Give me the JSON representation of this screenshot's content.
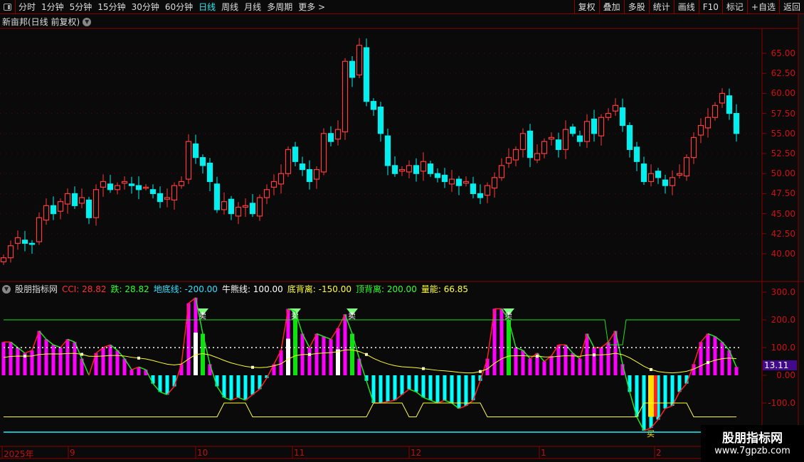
{
  "toolbar": {
    "periods": [
      "分时",
      "1分钟",
      "5分钟",
      "15分钟",
      "30分钟",
      "60分钟",
      "日线",
      "周线",
      "月线",
      "多周期",
      "更多 >"
    ],
    "active": "日线",
    "tools": [
      "复权",
      "叠加",
      "多股",
      "统计",
      "画线",
      "F10",
      "标记",
      "+自选",
      "返回"
    ]
  },
  "chart_title": "新亩邦(日线 前复权)",
  "price_axis": [
    "65.00",
    "62.50",
    "60.00",
    "57.50",
    "55.00",
    "52.50",
    "50.00",
    "47.50",
    "45.00",
    "42.50",
    "40.00"
  ],
  "indicator": {
    "name": "股朋指标网",
    "cci": "CCI: 28.82",
    "die": "跌: 28.82",
    "base": "地底线: -200.00",
    "bull": "牛熊线: 100.00",
    "bottom_div": "底背离: -150.00",
    "top_div": "顶背离: 200.00",
    "energy": "量能: 66.85",
    "current": "13.11",
    "axis": [
      "300.0",
      "200.0",
      "100.0",
      "0.00",
      "-100.0"
    ],
    "sell_label": "卖",
    "buy_label": "买"
  },
  "time_axis": [
    "2025年",
    "9",
    "10",
    "11",
    "12",
    "1",
    "2"
  ],
  "watermark": {
    "line1": "股朋指标网",
    "line2": "www.7gpzb.com"
  },
  "colors": {
    "up": "#ff3b3b",
    "down": "#00f0f0",
    "pos": "#ff00ff",
    "neg": "#00ffff",
    "axis": "#8b0000"
  },
  "chart_data": {
    "type": "candlestick",
    "closes": [
      39.5,
      41,
      42,
      41.3,
      41.2,
      44.5,
      46,
      45,
      46.5,
      47.5,
      46,
      47,
      44.5,
      48,
      49,
      48,
      48.5,
      49,
      48.5,
      48,
      48.3,
      47.5,
      46.5,
      47,
      48.5,
      49,
      54,
      52,
      51,
      49,
      45.5,
      46.5,
      45,
      45.8,
      46,
      45,
      47,
      48,
      49,
      50,
      53,
      51.5,
      50.5,
      49,
      50.5,
      55,
      54,
      55.5,
      64,
      62,
      66,
      59,
      58,
      55,
      51,
      50,
      50.5,
      51,
      50,
      51.5,
      50,
      49.5,
      49,
      49.3,
      48.5,
      49,
      47.5,
      47,
      48.5,
      49.5,
      51,
      52,
      53,
      55,
      52,
      52.5,
      54,
      54.5,
      53,
      55.5,
      55,
      54,
      56.5,
      55,
      57,
      57.5,
      58.5,
      56,
      53,
      51.5,
      49,
      50,
      49.5,
      48.5,
      49.5,
      50,
      52,
      54.5,
      56,
      57,
      58.5,
      60,
      57.5,
      55
    ],
    "cci": [
      120,
      120,
      100,
      80,
      90,
      160,
      130,
      110,
      100,
      130,
      120,
      60,
      0,
      80,
      100,
      110,
      90,
      60,
      20,
      30,
      20,
      -30,
      -60,
      -70,
      -40,
      40,
      260,
      280,
      150,
      40,
      -40,
      -80,
      -90,
      -80,
      -90,
      -70,
      -50,
      -10,
      40,
      90,
      240,
      230,
      150,
      100,
      150,
      140,
      130,
      170,
      220,
      150,
      60,
      -20,
      -100,
      -100,
      -95,
      -90,
      -70,
      -50,
      -60,
      -80,
      -90,
      -100,
      -90,
      -100,
      -120,
      -110,
      -90,
      -20,
      60,
      240,
      240,
      200,
      100,
      90,
      60,
      80,
      50,
      70,
      110,
      110,
      80,
      60,
      150,
      100,
      100,
      120,
      160,
      40,
      -60,
      -150,
      -200,
      -190,
      -160,
      -120,
      -110,
      -60,
      -30,
      40,
      120,
      150,
      140,
      120,
      90,
      30
    ],
    "sell_bars": [
      28,
      41,
      49,
      71
    ],
    "white_bars": [
      27,
      40,
      47
    ],
    "buy_bars": [
      91
    ],
    "top_line": 200,
    "bull_line": 100,
    "base_line": -200,
    "bottom_line": -150,
    "bottom_bumps": [
      [
        31,
        34
      ],
      [
        52,
        56
      ],
      [
        59,
        67
      ],
      [
        90,
        96
      ]
    ],
    "top_dip": [
      86,
      87
    ]
  }
}
